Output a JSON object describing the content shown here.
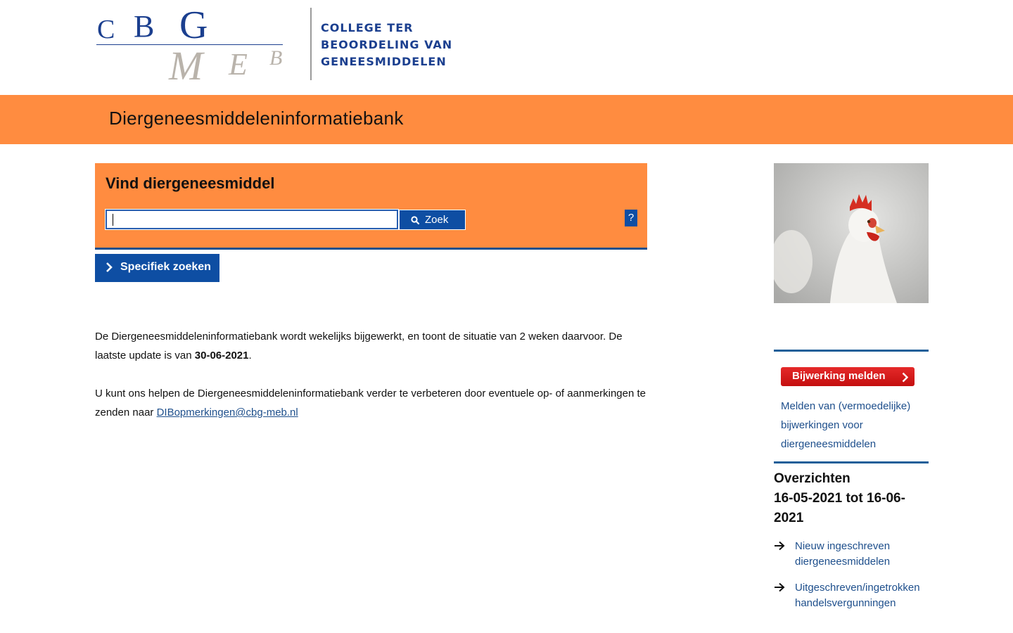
{
  "logo": {
    "letters_top": [
      "C",
      "B",
      "G"
    ],
    "letters_bottom": [
      "M",
      "E",
      "B"
    ],
    "org_name_lines": [
      "COLLEGE TER",
      "BEOORDELING VAN",
      "GENEESMIDDELEN"
    ]
  },
  "banner": {
    "title": "Diergeneesmiddeleninformatiebank"
  },
  "search": {
    "title": "Vind diergeneesmiddel",
    "input_value": "",
    "button_label": "Zoek",
    "help_label": "?"
  },
  "specific_search": {
    "label": "Specifiek zoeken"
  },
  "info": {
    "para1_text": "De Diergeneesmiddeleninformatiebank wordt wekelijks bijgewerkt, en toont de situatie van 2 weken daarvoor. De laatste update is van ",
    "para1_date": "30-06-2021",
    "para1_end": ".",
    "para2_text": "U kunt ons helpen de Diergeneesmiddeleninformatiebank verder te verbeteren door eventuele op- of aanmerkingen te zenden naar ",
    "para2_email": "DIBopmerkingen@cbg-meb.nl"
  },
  "sidebar": {
    "report_button": "Bijwerking melden",
    "report_description": "Melden van (vermoedelijke) bijwerkingen voor diergeneesmiddelen",
    "overview_title": "Overzichten",
    "overview_period": "16-05-2021 tot 16-06-2021",
    "links": [
      {
        "label": "Nieuw ingeschreven diergeneesmiddelen"
      },
      {
        "label": "Uitgeschreven/ingetrokken handelsvergunningen"
      }
    ]
  },
  "colors": {
    "orange": "#ff8c40",
    "blue": "#0e4ea3",
    "link_blue": "#1e4f8c",
    "report_red": "#d81d1d"
  }
}
